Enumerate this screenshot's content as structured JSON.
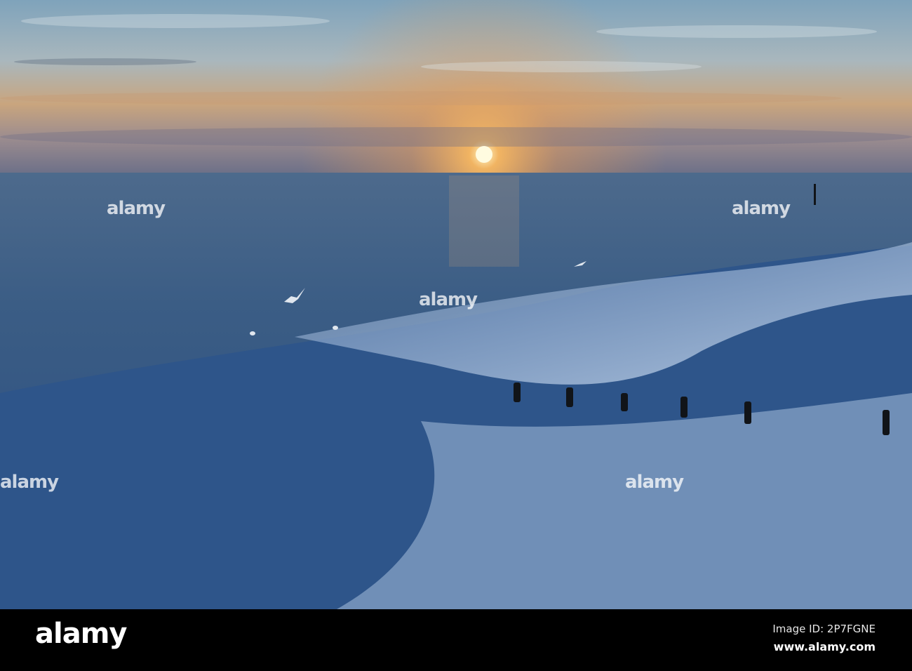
{
  "photo": {
    "subject": "Sunset over a rough sea with breaking waves and wooden groyne posts",
    "colors": {
      "sky_top": "#6f93ad",
      "sky_glow": "#e7a85a",
      "sun": "#fff4c0",
      "sea_far": "#3f5f82",
      "sea_near": "#2c4f7c",
      "foam": "#c9d8ea"
    }
  },
  "watermark": {
    "text": "alamy"
  },
  "footer": {
    "logo": "alamy",
    "image_id": "Image ID: 2P7FGNE",
    "website": "www.alamy.com"
  }
}
